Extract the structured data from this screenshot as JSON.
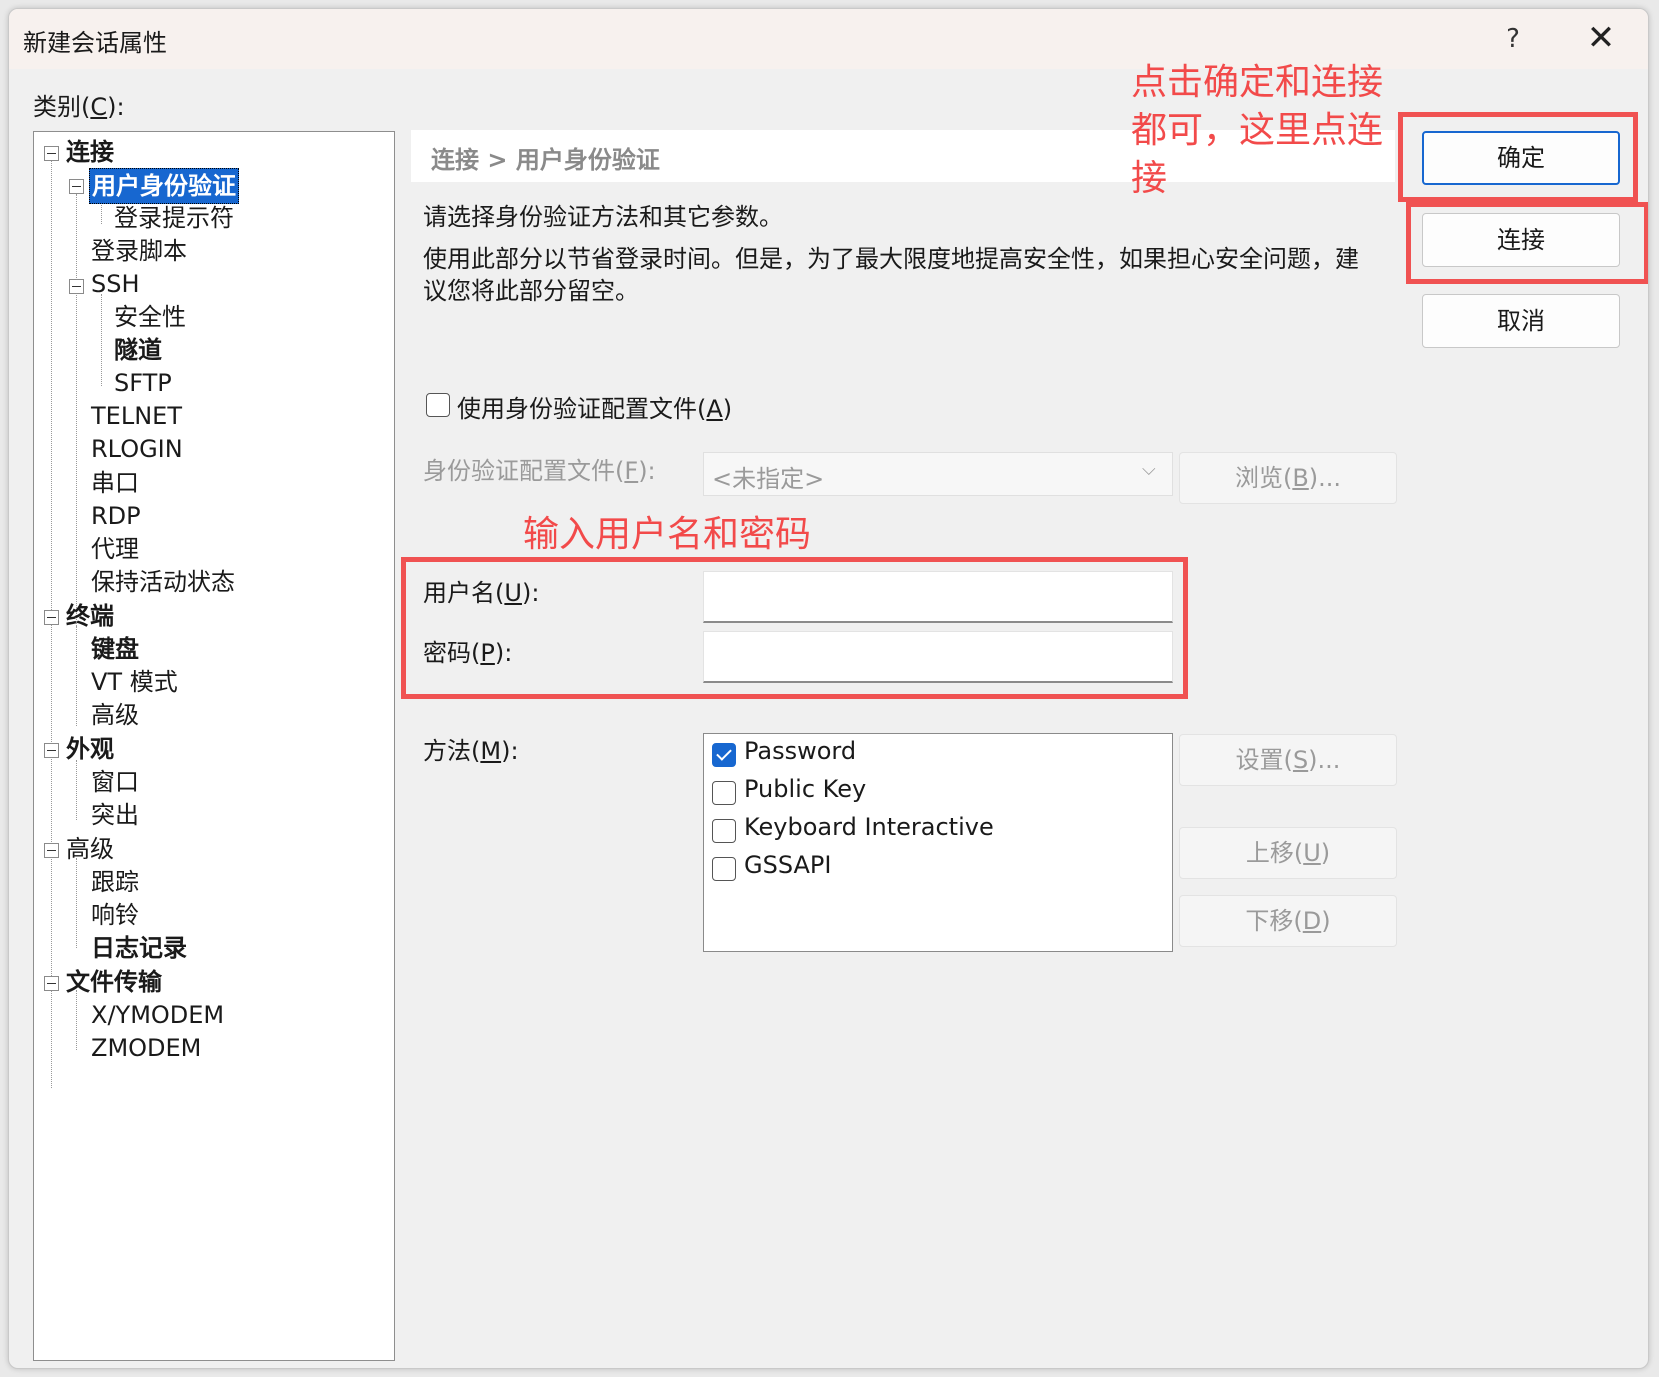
{
  "window": {
    "title": "新建会话属性",
    "help_glyph": "?",
    "close_glyph": "✕"
  },
  "category": {
    "label": "类别(",
    "accel": "C",
    "label_end": "):"
  },
  "tree": {
    "connection": "连接",
    "user_auth": "用户身份验证",
    "login_prompt": "登录提示符",
    "login_script": "登录脚本",
    "ssh": "SSH",
    "security": "安全性",
    "tunnel": "隧道",
    "sftp": "SFTP",
    "telnet": "TELNET",
    "rlogin": "RLOGIN",
    "serial": "串口",
    "rdp": "RDP",
    "proxy": "代理",
    "keepalive": "保持活动状态",
    "terminal": "终端",
    "keyboard": "键盘",
    "vt_mode": "VT 模式",
    "term_advanced": "高级",
    "appearance": "外观",
    "window": "窗口",
    "highlight": "突出",
    "advanced": "高级",
    "trace": "跟踪",
    "bell": "响铃",
    "log": "日志记录",
    "file_transfer": "文件传输",
    "xymodem": "X/YMODEM",
    "zmodem": "ZMODEM"
  },
  "panel": {
    "breadcrumb": "连接 > 用户身份验证",
    "desc1": "请选择身份验证方法和其它参数。",
    "desc2_line1": "使用此部分以节省登录时间。但是，为了最大限度地提高安全性，如果担心安全问题，建",
    "desc2_line2": "议您将此部分留空。",
    "use_profile_label": "使用身份验证配置文件(",
    "use_profile_accel": "A",
    "use_profile_end": ")",
    "profile_label": "身份验证配置文件(",
    "profile_accel": "F",
    "profile_end": "):",
    "profile_value": "<未指定>",
    "browse_label": "浏览(",
    "browse_accel": "B",
    "browse_end": ")...",
    "username_label": "用户名(",
    "username_accel": "U",
    "username_end": "):",
    "username_value": "",
    "password_label": "密码(",
    "password_accel": "P",
    "password_end": "):",
    "password_value": "",
    "method_label": "方法(",
    "method_accel": "M",
    "method_end": "):",
    "methods": [
      {
        "label": "Password",
        "checked": true
      },
      {
        "label": "Public Key",
        "checked": false
      },
      {
        "label": "Keyboard Interactive",
        "checked": false
      },
      {
        "label": "GSSAPI",
        "checked": false
      }
    ],
    "settings_label": "设置(",
    "settings_accel": "S",
    "settings_end": ")...",
    "move_up_label": "上移(",
    "move_up_accel": "U",
    "move_up_end": ")",
    "move_down_label": "下移(",
    "move_down_accel": "D",
    "move_down_end": ")"
  },
  "buttons": {
    "ok": "确定",
    "connect": "连接",
    "cancel": "取消"
  },
  "annotations": {
    "top_note": "点击确定和连接\n都可，这里点连\n接",
    "credentials_note": "输入用户名和密码",
    "color": "#f24a4a"
  }
}
